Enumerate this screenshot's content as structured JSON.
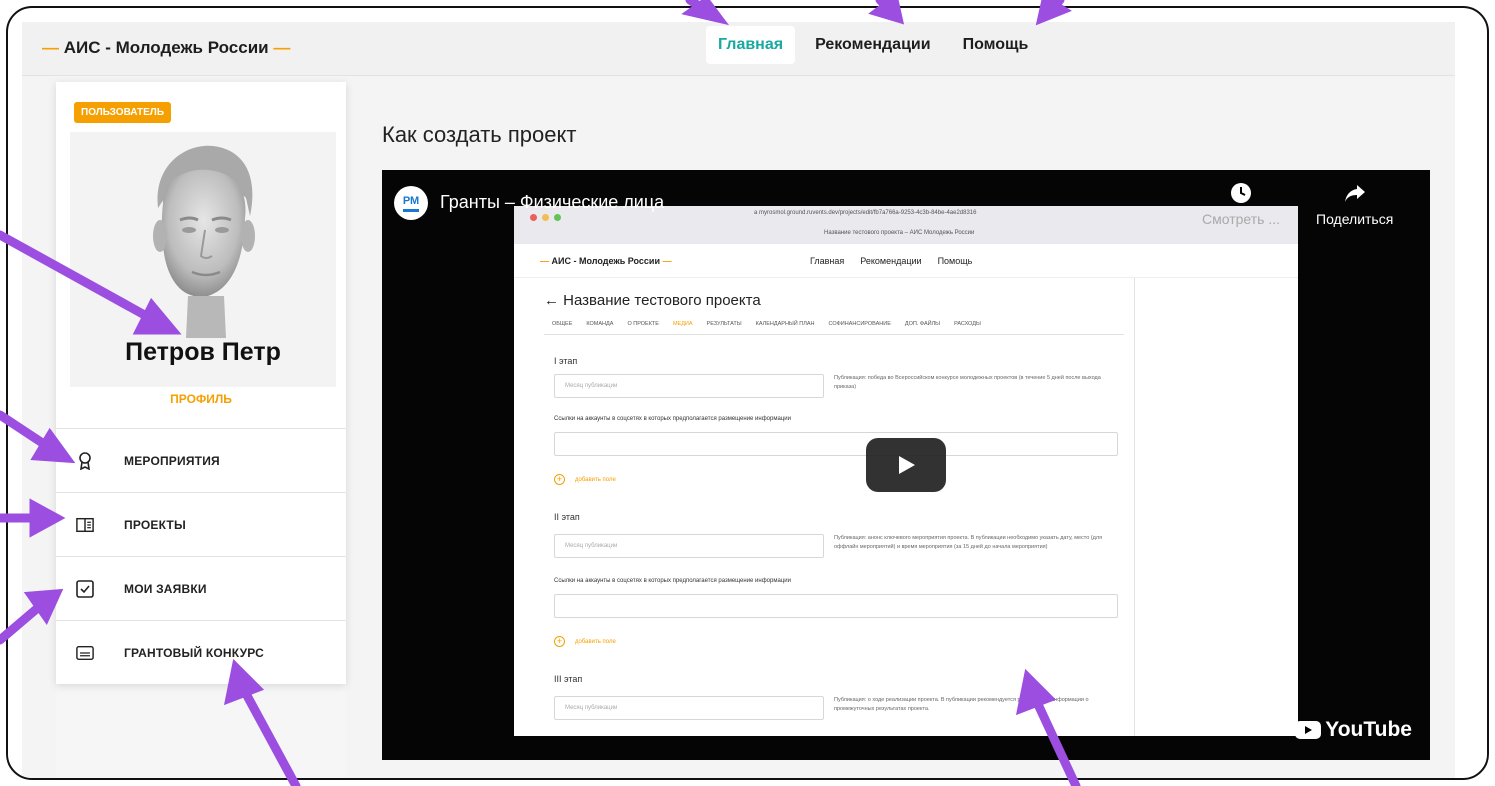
{
  "header": {
    "brand": "АИС - Молодежь России",
    "nav": [
      {
        "label": "Главная",
        "active": true
      },
      {
        "label": "Рекомендации",
        "active": false
      },
      {
        "label": "Помощь",
        "active": false
      }
    ]
  },
  "sidebar": {
    "role_badge": "ПОЛЬЗОВАТЕЛЬ",
    "user_name": "Петров Петр",
    "profile_link": "ПРОФИЛЬ",
    "items": [
      {
        "label": "МЕРОПРИЯТИЯ",
        "icon": "award-icon"
      },
      {
        "label": "ПРОЕКТЫ",
        "icon": "document-panel-icon"
      },
      {
        "label": "МОИ ЗАЯВКИ",
        "icon": "checkbox-icon"
      },
      {
        "label": "ГРАНТОВЫЙ КОНКУРС",
        "icon": "subtitles-icon"
      }
    ]
  },
  "main": {
    "title": "Как создать проект",
    "video": {
      "channel_initials": "РМ",
      "title": "Гранты – Физические лица",
      "watch_later": "Смотреть ...",
      "share": "Поделиться",
      "logo": "YouTube",
      "inner": {
        "url": "a myrosmol.ground.ruvents.dev/projects/edit/fb7a766a-9253-4c3b-84be-4ae2d8316",
        "tab": "Название тестового проекта – АИС Молодежь России",
        "brand": "АИС - Молодежь России",
        "nav": [
          "Главная",
          "Рекомендации",
          "Помощь"
        ],
        "heading": "← Название тестового проекта",
        "tabs": [
          "ОБЩЕЕ",
          "КОМАНДА",
          "О ПРОЕКТЕ",
          "МЕДИА",
          "РЕЗУЛЬТАТЫ",
          "КАЛЕНДАРНЫЙ ПЛАН",
          "СОФИНАНСИРОВАНИЕ",
          "ДОП. ФАЙЛЫ",
          "РАСХОДЫ"
        ],
        "active_tab": "МЕДИА",
        "stage1": "I этап",
        "stage2": "II этап",
        "stage3": "III этап",
        "month_placeholder": "Месяц публикации",
        "links_label": "Ссылки на аккаунты в соцсетях в которых предполагается размещение информации",
        "add_field": "добавить поле",
        "note1": "Публикация: победа во Всероссийском конкурсе молодежных проектов (в течение 5 дней после выхода приказа)",
        "note2": "Публикация: анонс ключевого мероприятия проекта. В публикации необходимо указать дату, место (для оффлайн мероприятий) и время мероприятия (за 15 дней до начала мероприятия)",
        "note3": "Публикация: о ходе реализации проекта. В публикации рекомендуется размещение информации о промежуточных результатах проекта."
      }
    }
  },
  "colors": {
    "accent_orange": "#f5a000",
    "nav_active_teal": "#19a9a0",
    "annotation_purple": "#9b4ee0"
  }
}
